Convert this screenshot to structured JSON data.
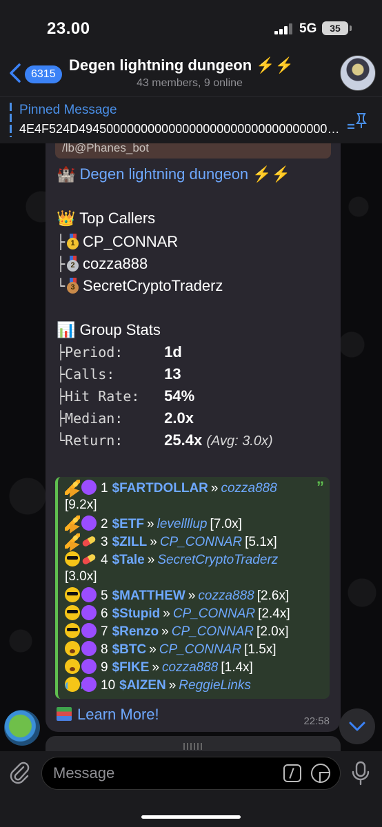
{
  "status_bar": {
    "time": "23.00",
    "network": "5G",
    "battery": "35"
  },
  "header": {
    "unread_count": "6315",
    "title": "Degen lightning dungeon ⚡️⚡️",
    "subtitle": "43 members, 9 online"
  },
  "pinned": {
    "label": "Pinned Message",
    "text": "4E4F524D4945000000000000000000000000000000000000"
  },
  "message": {
    "reply_preview": "/lb@Phanes_bot",
    "title": "🏰 Degen lightning dungeon ⚡️⚡️",
    "top_callers_title": "👑 Top Callers",
    "top_callers": [
      {
        "branch": "├",
        "place": "1",
        "name": "CP_CONNAR"
      },
      {
        "branch": "├",
        "place": "2",
        "name": "cozza888"
      },
      {
        "branch": "└",
        "place": "3",
        "name": "SecretCryptoTraderz"
      }
    ],
    "group_stats_title": "📊 Group Stats",
    "group_stats": [
      {
        "label": "├Period:",
        "value": "1d",
        "note": ""
      },
      {
        "label": "├Calls:",
        "value": "13",
        "note": ""
      },
      {
        "label": "├Hit Rate:",
        "value": "54%",
        "note": ""
      },
      {
        "label": "├Median:",
        "value": "2.0x",
        "note": ""
      },
      {
        "label": "└Return:",
        "value": "25.4x",
        "note": "(Avg: 3.0x)"
      }
    ],
    "quote_mark": "”",
    "rankings": [
      {
        "icons": [
          "party",
          "purple"
        ],
        "rank": "1",
        "ticker": "$FARTDOLLAR",
        "caller": "cozza888",
        "mult": "[9.2x]",
        "wrap": true
      },
      {
        "icons": [
          "party",
          "purple"
        ],
        "rank": "2",
        "ticker": "$ETF",
        "caller": "levellllup",
        "mult": "[7.0x]",
        "wrap": false
      },
      {
        "icons": [
          "party",
          "pill"
        ],
        "rank": "3",
        "ticker": "$ZILL",
        "caller": "CP_CONNAR",
        "mult": "[5.1x]",
        "wrap": false
      },
      {
        "icons": [
          "cool",
          "pill"
        ],
        "rank": "4",
        "ticker": "$Tale",
        "caller": "SecretCryptoTraderz",
        "mult": "[3.0x]",
        "wrap": true
      },
      {
        "icons": [
          "cool",
          "purple"
        ],
        "rank": "5",
        "ticker": "$MATTHEW",
        "caller": "cozza888",
        "mult": "[2.6x]",
        "wrap": false
      },
      {
        "icons": [
          "cool",
          "purple"
        ],
        "rank": "6",
        "ticker": "$Stupid",
        "caller": "CP_CONNAR",
        "mult": "[2.4x]",
        "wrap": false
      },
      {
        "icons": [
          "cool",
          "purple"
        ],
        "rank": "7",
        "ticker": "$Renzo",
        "caller": "CP_CONNAR",
        "mult": "[2.0x]",
        "wrap": false
      },
      {
        "icons": [
          "yawn",
          "purple"
        ],
        "rank": "8",
        "ticker": "$BTC",
        "caller": "CP_CONNAR",
        "mult": "[1.5x]",
        "wrap": false
      },
      {
        "icons": [
          "yawn",
          "purple"
        ],
        "rank": "9",
        "ticker": "$FIKE",
        "caller": "cozza888",
        "mult": "[1.4x]",
        "wrap": false
      },
      {
        "icons": [
          "sob",
          "purple"
        ],
        "rank": "10",
        "ticker": "$AIZEN",
        "caller": "ReggieLinks",
        "mult": "",
        "wrap": false
      }
    ],
    "learn_more": "Learn More!",
    "time": "22:58"
  },
  "composer": {
    "placeholder": "Message"
  },
  "colors": {
    "accent": "#6ea8fe",
    "quote_border": "#5fbf4f",
    "badge": "#3b82f6"
  }
}
